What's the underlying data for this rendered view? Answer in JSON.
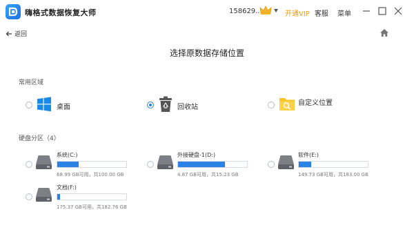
{
  "app": {
    "title": "嗨格式数据恢复大师",
    "user_id": "158629...",
    "vip_label": "开通VIP",
    "service_label": "客服",
    "menu_label": "菜单"
  },
  "nav": {
    "back_label": "返回"
  },
  "page": {
    "title": "选择原数据存储位置"
  },
  "common_areas": {
    "label": "常用区域",
    "items": [
      {
        "label": "桌面",
        "icon": "windows-desktop-icon",
        "selected": false
      },
      {
        "label": "回收站",
        "icon": "recycle-bin-icon",
        "selected": true
      },
      {
        "label": "自定义位置",
        "icon": "folder-search-icon",
        "selected": false
      }
    ]
  },
  "disk_partitions": {
    "label": "硬盘分区（4）",
    "drives": [
      {
        "name": "系统(C:)",
        "used_fraction": 0.31,
        "stats": "68.99 GB可用，共100.00 GB"
      },
      {
        "name": "外接硬盘-1(D:)",
        "used_fraction": 0.68,
        "stats": "4.87 GB可用，共15.23 GB"
      },
      {
        "name": "软件(E:)",
        "used_fraction": 0.18,
        "stats": "149.73 GB可用，共183.00 GB"
      },
      {
        "name": "文档(F:)",
        "used_fraction": 0.04,
        "stats": "175.37 GB可用，共182.76 GB"
      }
    ]
  },
  "colors": {
    "accent": "#2a7de1",
    "drive_fill": "#2a82e4",
    "vip": "#f29a00",
    "folder": "#f7c325"
  }
}
